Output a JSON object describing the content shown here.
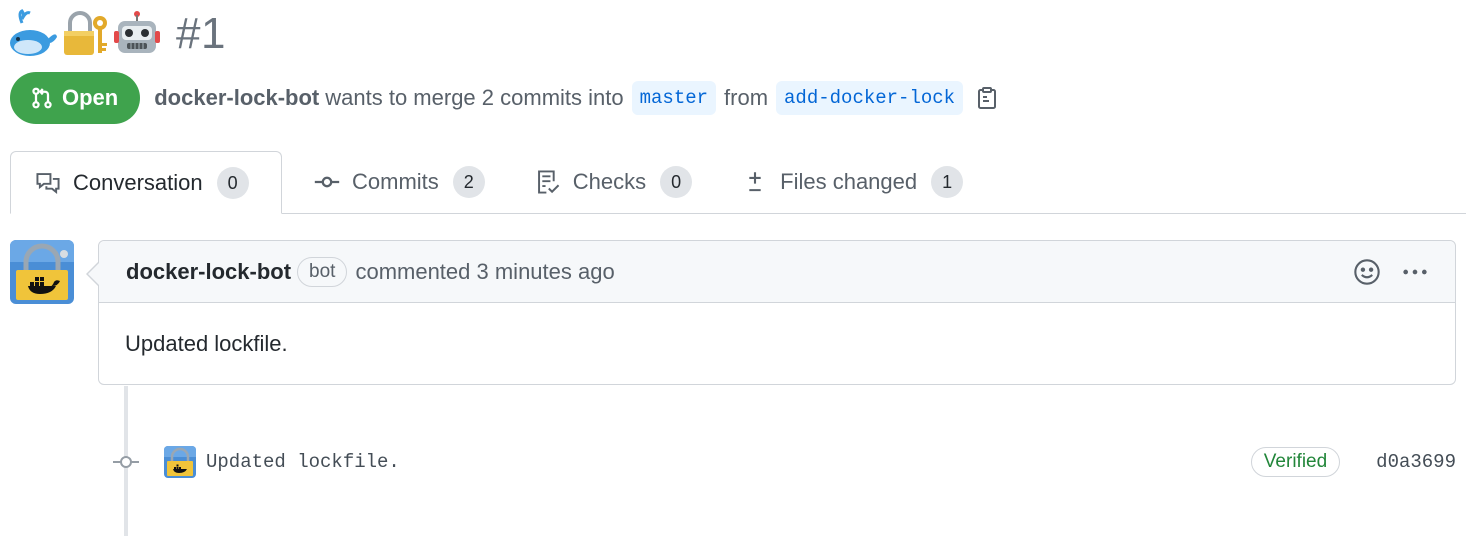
{
  "title": {
    "emojis": [
      "whale-emoji",
      "lock-with-key-emoji",
      "robot-emoji"
    ],
    "number": "#1"
  },
  "status": {
    "state": "Open",
    "author": "docker-lock-bot",
    "text_merge": "wants to merge 2 commits into",
    "base_branch": "master",
    "text_from": "from",
    "head_branch": "add-docker-lock",
    "state_color": "#3fa34d"
  },
  "tabs": [
    {
      "label": "Conversation",
      "count": "0",
      "icon": "comment-discussion-icon"
    },
    {
      "label": "Commits",
      "count": "2",
      "icon": "git-commit-icon"
    },
    {
      "label": "Checks",
      "count": "0",
      "icon": "checklist-icon"
    },
    {
      "label": "Files changed",
      "count": "1",
      "icon": "diff-icon"
    }
  ],
  "comment": {
    "author": "docker-lock-bot",
    "badge": "bot",
    "meta": "commented 3 minutes ago",
    "body": "Updated lockfile."
  },
  "commit": {
    "message": "Updated lockfile.",
    "verified": "Verified",
    "sha": "d0a3699"
  }
}
